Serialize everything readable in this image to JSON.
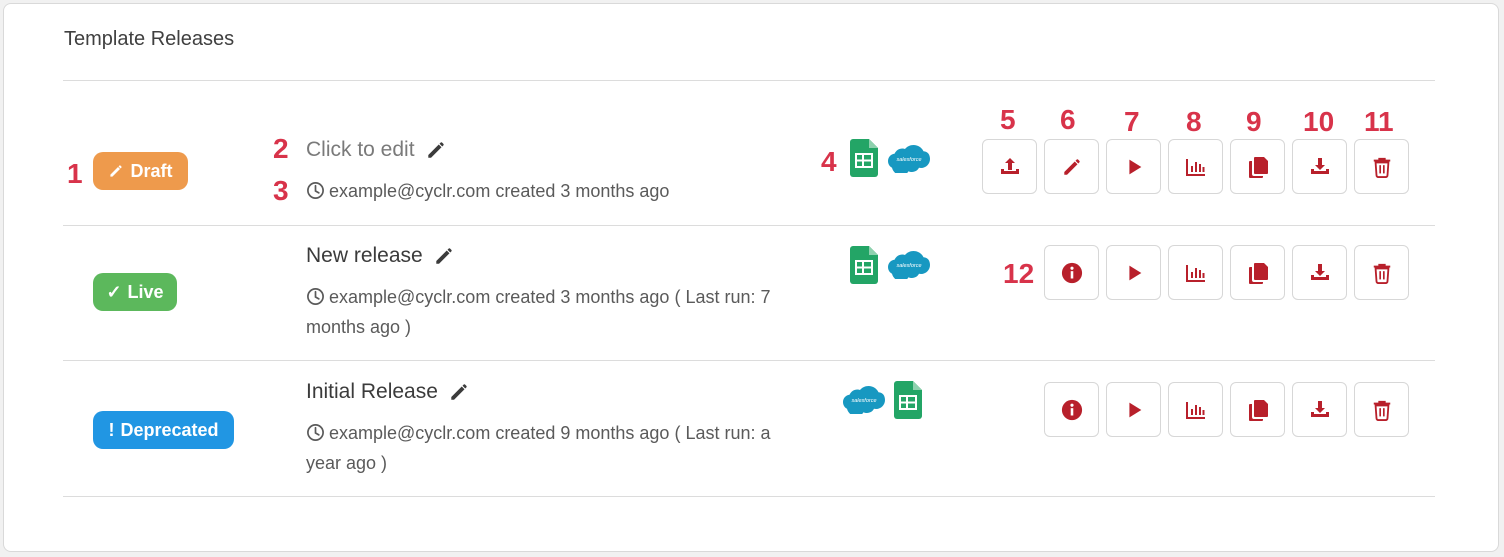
{
  "title": "Template Releases",
  "annotations": [
    "1",
    "2",
    "3",
    "4",
    "5",
    "6",
    "7",
    "8",
    "9",
    "10",
    "11",
    "12"
  ],
  "releases": [
    {
      "status": "Draft",
      "status_icon": "pencil-icon",
      "name": "Click to edit",
      "created": "example@cyclr.com created 3 months ago",
      "last_run": "",
      "connectors": [
        "google-sheets-icon",
        "salesforce-icon"
      ]
    },
    {
      "status": "Live",
      "status_icon": "check-icon",
      "name": "New release",
      "created": "example@cyclr.com created 3 months ago",
      "last_run": "( Last run: 7 months ago )",
      "connectors": [
        "google-sheets-icon",
        "salesforce-icon"
      ]
    },
    {
      "status": "Deprecated",
      "status_icon": "exclamation-icon",
      "name": "Initial Release",
      "created": "example@cyclr.com created 9 months ago",
      "last_run": "( Last run: a year ago )",
      "connectors": [
        "salesforce-icon",
        "google-sheets-icon"
      ]
    }
  ],
  "actions": {
    "row1": [
      "publish-icon",
      "edit-icon",
      "run-icon",
      "stats-icon",
      "copy-icon",
      "download-icon",
      "delete-icon"
    ],
    "row2": [
      "info-icon",
      "run-icon",
      "stats-icon",
      "copy-icon",
      "download-icon",
      "delete-icon"
    ],
    "row3": [
      "info-icon",
      "run-icon",
      "stats-icon",
      "copy-icon",
      "download-icon",
      "delete-icon"
    ]
  },
  "colors": {
    "accent": "#b8202b",
    "annotation": "#d8334a",
    "draft": "#ee9a4c",
    "live": "#5cb85c",
    "deprecated": "#2196e3",
    "sheets": "#23a566",
    "salesforce": "#1798c1"
  }
}
